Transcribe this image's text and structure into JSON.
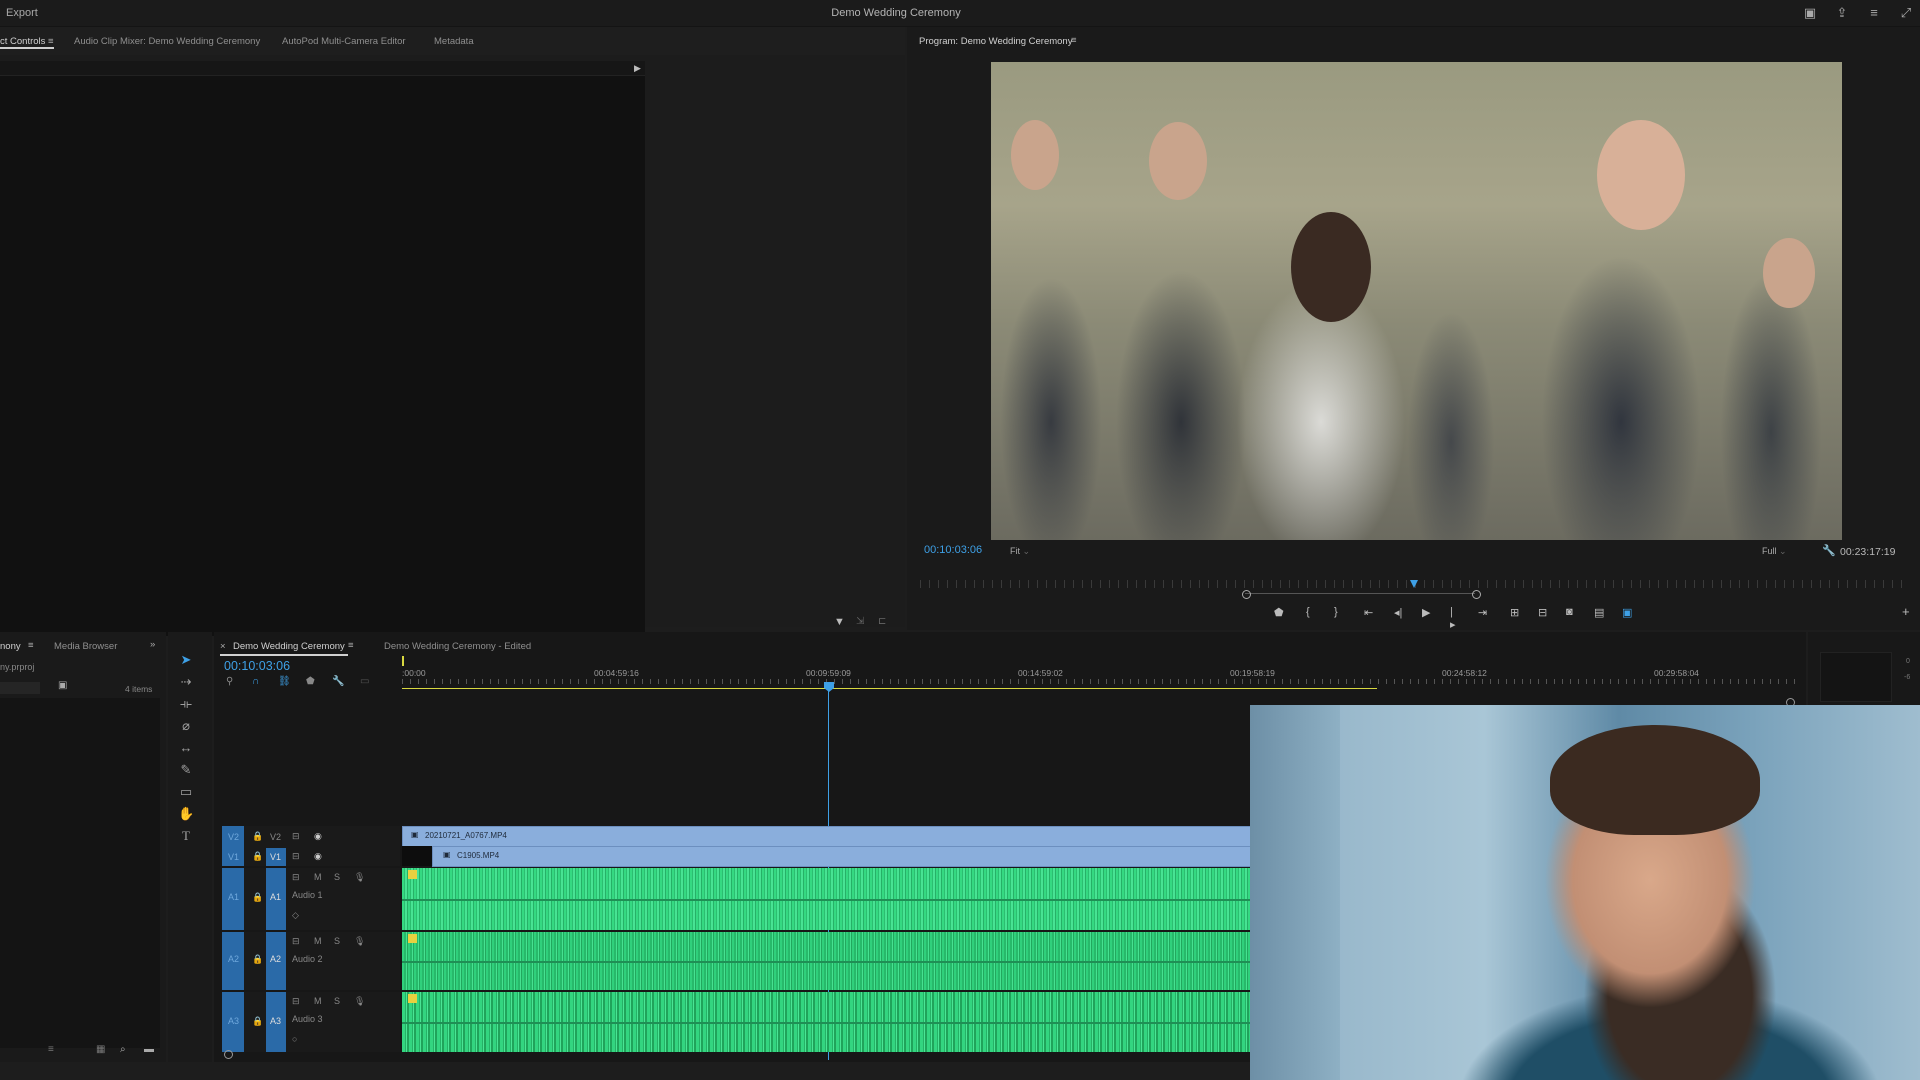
{
  "topbar": {
    "export_label": "Export",
    "title": "Demo Wedding Ceremony"
  },
  "left_panel": {
    "tabs": [
      {
        "label": "ct Controls"
      },
      {
        "label": "Audio Clip Mixer: Demo Wedding Ceremony"
      },
      {
        "label": "AutoPod Multi-Camera Editor"
      },
      {
        "label": "Metadata"
      }
    ]
  },
  "program_monitor": {
    "tab_label": "Program: Demo Wedding Ceremony",
    "current_time": "00:10:03:06",
    "fit_label": "Fit",
    "quality_label": "Full",
    "duration": "00:23:17:19"
  },
  "project_panel": {
    "tab_label": "nony",
    "media_browser_label": "Media Browser",
    "file_label": "ny.prproj",
    "items_count": "4 items"
  },
  "timeline": {
    "tab_label": "Demo Wedding Ceremony",
    "tab2_label": "Demo Wedding Ceremony - Edited",
    "current_time": "00:10:03:06",
    "ruler_ticks": [
      ":00:00",
      "00:04:59:16",
      "00:09:59:09",
      "00:14:59:02",
      "00:19:58:19",
      "00:24:58:12",
      "00:29:58:04"
    ],
    "tracks": {
      "v2_label": "V2",
      "v1_label": "V1",
      "a1_label": "A1",
      "a2_label": "A2",
      "a3_label": "A3",
      "audio1_name": "Audio 1",
      "audio2_name": "Audio 2",
      "audio3_name": "Audio 3",
      "mute_label": "M",
      "solo_label": "S"
    },
    "clips": {
      "v2_clip": "20210721_A0767.MP4",
      "v1_clip": "C1905.MP4"
    },
    "meter_labels": [
      "0",
      "-6"
    ]
  },
  "colors": {
    "accent_blue": "#3ea0e6",
    "audio_green": "#2fcf7a",
    "video_clip": "#8aaedc"
  }
}
